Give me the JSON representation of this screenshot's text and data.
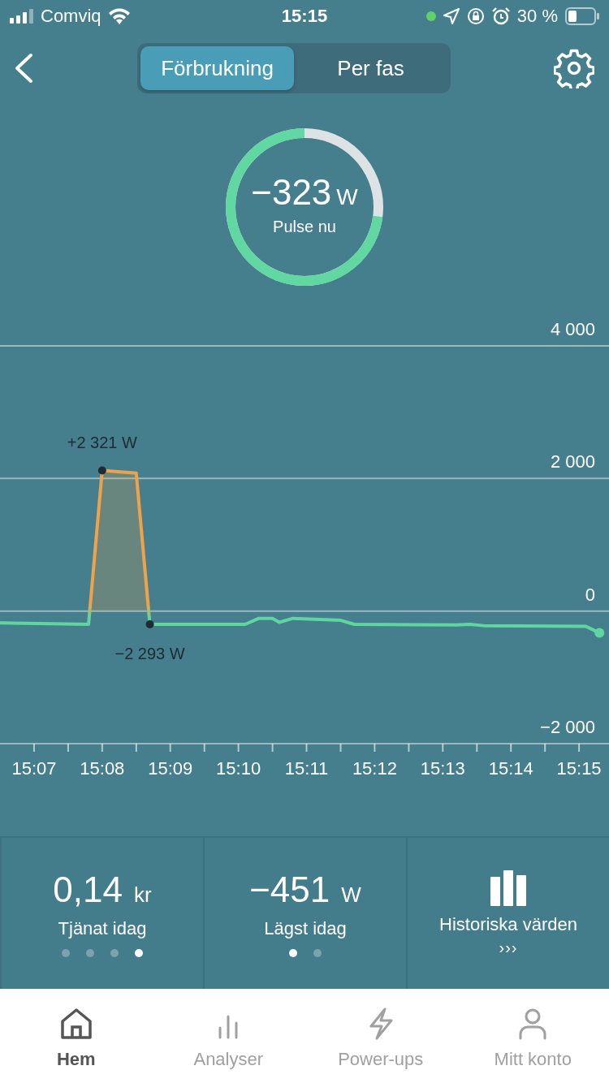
{
  "status_bar": {
    "carrier": "Comviq",
    "time": "15:15",
    "battery": "30 %"
  },
  "header": {
    "tabs": [
      {
        "label": "Förbrukning",
        "selected": true
      },
      {
        "label": "Per fas",
        "selected": false
      }
    ]
  },
  "gauge": {
    "value": "−323",
    "unit": "W",
    "label": "Pulse nu",
    "level": 0.73
  },
  "chart_data": {
    "type": "area",
    "x": [
      906.5,
      907.8,
      908,
      908.5,
      908.7,
      910.1,
      910.3,
      910.5,
      910.6,
      910.8,
      911.5,
      911.7,
      913.2,
      913.4,
      913.6,
      915.1,
      915.3
    ],
    "series": [
      {
        "color": "#5fd6a0",
        "values": [
          -180,
          -200,
          2120,
          2080,
          -200,
          -200,
          -110,
          -110,
          -170,
          -110,
          -140,
          -200,
          -210,
          -200,
          -220,
          -230,
          -330
        ]
      }
    ],
    "xlim": [
      906.5,
      915.44
    ],
    "ylim": [
      -2000,
      4000
    ],
    "xticks": [
      {
        "value": 907,
        "label": "15:07"
      },
      {
        "value": 908,
        "label": "15:08"
      },
      {
        "value": 909,
        "label": "15:09"
      },
      {
        "value": 910,
        "label": "15:10"
      },
      {
        "value": 911,
        "label": "15:11"
      },
      {
        "value": 912,
        "label": "15:12"
      },
      {
        "value": 913,
        "label": "15:13"
      },
      {
        "value": 914,
        "label": "15:14"
      },
      {
        "value": 915,
        "label": "15:15"
      }
    ],
    "yticks": [
      {
        "value": 4000,
        "label": "4 000"
      },
      {
        "value": 2000,
        "label": "2 000"
      },
      {
        "value": 0,
        "label": "0"
      },
      {
        "value": -2000,
        "label": "−2 000"
      }
    ],
    "annotations": [
      {
        "x": 908,
        "y": 2120,
        "text": "+2 321 W"
      },
      {
        "x": 908.7,
        "y": -200,
        "text": "−2 293 W"
      }
    ]
  },
  "stats": [
    {
      "kind": "value",
      "value": "0,14",
      "unit": "kr",
      "label": "Tjänat idag",
      "pages": [
        {
          "selected": false
        },
        {
          "selected": false
        },
        {
          "selected": false
        },
        {
          "selected": true
        }
      ]
    },
    {
      "kind": "value",
      "value": "−451",
      "unit": "W",
      "label": "Lägst idag",
      "pages": [
        {
          "selected": true
        },
        {
          "selected": false
        }
      ]
    },
    {
      "kind": "link",
      "label": "Historiska värden",
      "more": "›››"
    }
  ],
  "tab_bar": [
    {
      "label": "Hem",
      "selected": true
    },
    {
      "label": "Analyser",
      "selected": false
    },
    {
      "label": "Power-ups",
      "selected": false
    },
    {
      "label": "Mitt konto",
      "selected": false
    }
  ]
}
